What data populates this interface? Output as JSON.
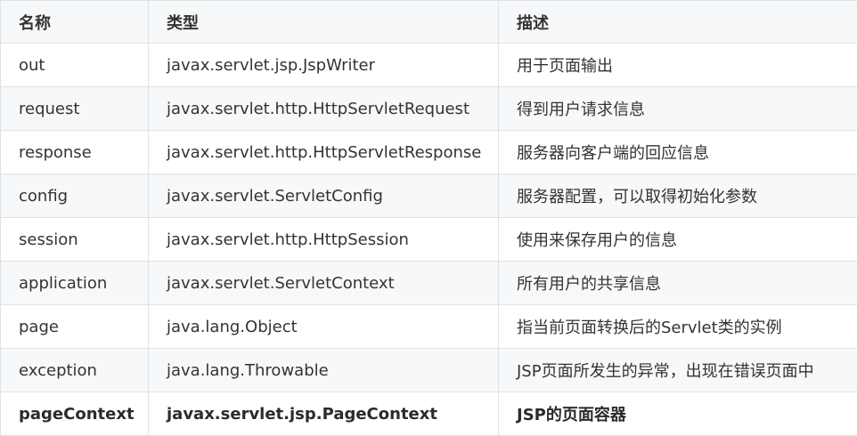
{
  "table": {
    "headers": [
      "名称",
      "类型",
      "描述"
    ],
    "rows": [
      {
        "name": "out",
        "type": "javax.servlet.jsp.JspWriter",
        "desc": "用于页面输出",
        "bold": false
      },
      {
        "name": "request",
        "type": "javax.servlet.http.HttpServletRequest",
        "desc": "得到用户请求信息",
        "bold": false
      },
      {
        "name": "response",
        "type": "javax.servlet.http.HttpServletResponse",
        "desc": "服务器向客户端的回应信息",
        "bold": false
      },
      {
        "name": "config",
        "type": "javax.servlet.ServletConfig",
        "desc": "服务器配置，可以取得初始化参数",
        "bold": false
      },
      {
        "name": "session",
        "type": "javax.servlet.http.HttpSession",
        "desc": "使用来保存用户的信息",
        "bold": false
      },
      {
        "name": "application",
        "type": "javax.servlet.ServletContext",
        "desc": "所有用户的共享信息",
        "bold": false
      },
      {
        "name": "page",
        "type": "java.lang.Object",
        "desc": "指当前页面转换后的Servlet类的实例",
        "bold": false
      },
      {
        "name": "exception",
        "type": "java.lang.Throwable",
        "desc": "JSP页面所发生的异常，出现在错误页面中",
        "bold": false
      },
      {
        "name": "pageContext",
        "type": "javax.servlet.jsp.PageContext",
        "desc": "JSP的页面容器",
        "bold": true
      }
    ]
  },
  "colors": {
    "border": "#dfe2e5",
    "header_bg": "#f6f8fa",
    "stripe_bg": "#f6f8fa",
    "text": "#333333"
  }
}
